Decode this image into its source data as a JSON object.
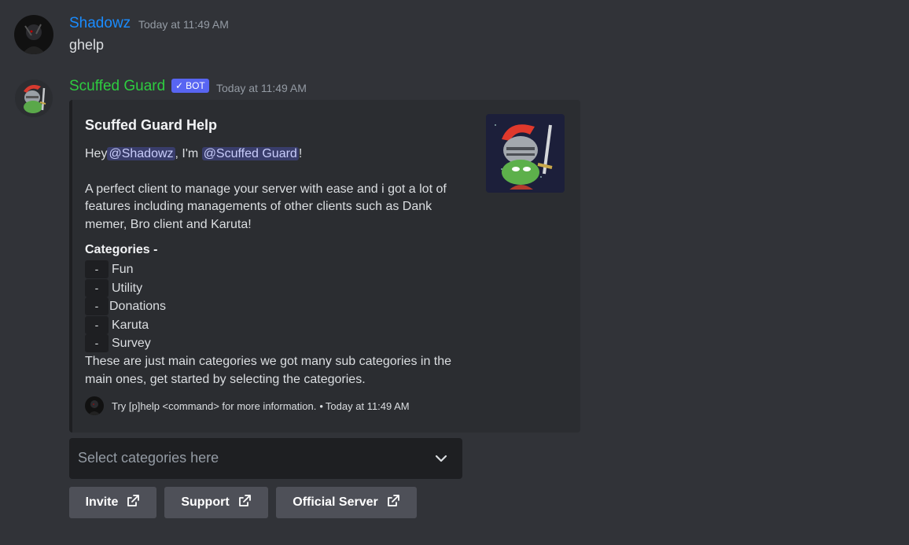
{
  "messages": [
    {
      "username": "Shadowz",
      "username_color": "#1a8cff",
      "timestamp": "Today at 11:49 AM",
      "text": "ghelp"
    },
    {
      "username": "Scuffed Guard",
      "username_color": "#2ecc40",
      "badge": "BOT",
      "timestamp": "Today at 11:49 AM"
    }
  ],
  "embed": {
    "title": "Scuffed Guard Help",
    "greeting_prefix": "Hey",
    "mention_user": "@Shadowz",
    "greeting_middle": ", I'm",
    "mention_bot": "@Scuffed Guard",
    "greeting_suffix": "!",
    "description_lines": [
      "A perfect client to manage your server with ease and i got a lot of",
      "features including managements of other clients such as Dank",
      "memer, Bro client and Karuta!"
    ],
    "categories_heading": "Categories -",
    "categories": [
      {
        "dash": "-",
        "name": "Fun"
      },
      {
        "dash": "-",
        "name": "Utility"
      },
      {
        "dash": "-",
        "name": "Donations"
      },
      {
        "dash": "-",
        "name": "Karuta"
      },
      {
        "dash": "-",
        "name": "Survey"
      }
    ],
    "closing_lines": [
      "These are just main categories we got many sub categories in the",
      "main ones, get started by selecting the categories."
    ],
    "footer": {
      "text": "Try [p]help <command> for more information.",
      "separator": "•",
      "timestamp": "Today at 11:49 AM"
    }
  },
  "select": {
    "placeholder": "Select categories here",
    "icon": "chevron-down-icon"
  },
  "buttons": [
    {
      "label": "Invite",
      "icon": "external-link-icon"
    },
    {
      "label": "Support",
      "icon": "external-link-icon"
    },
    {
      "label": "Official Server",
      "icon": "external-link-icon"
    }
  ],
  "colors": {
    "background": "#313338",
    "embed_bg": "#2b2d31",
    "button_bg": "#4e5058",
    "badge_bg": "#5865f2"
  }
}
